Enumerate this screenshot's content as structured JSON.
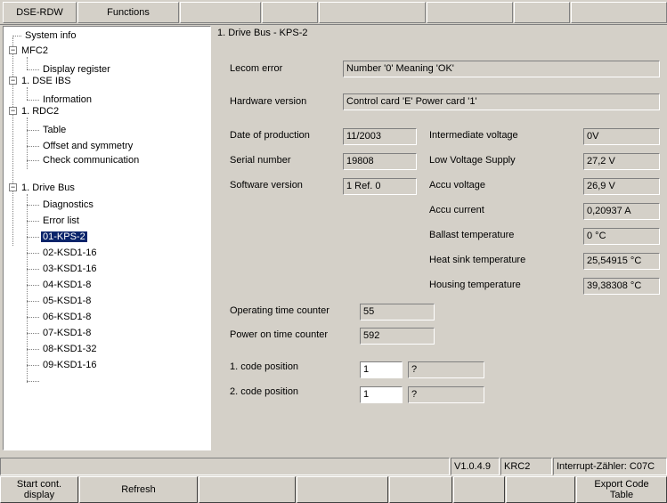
{
  "menu": {
    "tabs": [
      "DSE-RDW",
      "Functions"
    ]
  },
  "tree": {
    "items": [
      {
        "label": "System info"
      },
      {
        "label": "MFC2"
      },
      {
        "label": "Display register"
      },
      {
        "label": "1. DSE IBS"
      },
      {
        "label": "Information"
      },
      {
        "label": "1. RDC2"
      },
      {
        "label": "Table"
      },
      {
        "label": "Offset and symmetry"
      },
      {
        "label": "Check communication"
      },
      {
        "label": "1. Drive Bus"
      },
      {
        "label": "Diagnostics"
      },
      {
        "label": "Error list"
      },
      {
        "label": "01-KPS-2",
        "selected": true
      },
      {
        "label": "02-KSD1-16"
      },
      {
        "label": "03-KSD1-16"
      },
      {
        "label": "04-KSD1-8"
      },
      {
        "label": "05-KSD1-8"
      },
      {
        "label": "06-KSD1-8"
      },
      {
        "label": "07-KSD1-8"
      },
      {
        "label": "08-KSD1-32"
      },
      {
        "label": "09-KSD1-16"
      }
    ]
  },
  "panel": {
    "title": "1. Drive Bus - KPS-2",
    "lecom_error": {
      "label": "Lecom error",
      "value": "Number '0'  Meaning 'OK'"
    },
    "hardware_version": {
      "label": "Hardware version",
      "value": "Control card 'E'  Power card '1'"
    },
    "date_of_production": {
      "label": "Date of production",
      "value": "11/2003"
    },
    "serial_number": {
      "label": "Serial number",
      "value": "19808"
    },
    "software_version": {
      "label": "Software version",
      "value": "1 Ref. 0"
    },
    "intermediate_voltage": {
      "label": "Intermediate voltage",
      "value": "0V"
    },
    "low_voltage_supply": {
      "label": "Low Voltage Supply",
      "value": "27,2 V"
    },
    "accu_voltage": {
      "label": "Accu voltage",
      "value": "26,9 V"
    },
    "accu_current": {
      "label": "Accu current",
      "value": "0,20937 A"
    },
    "ballast_temperature": {
      "label": "Ballast temperature",
      "value": "0 °C"
    },
    "heat_sink_temperature": {
      "label": "Heat sink temperature",
      "value": "25,54915 °C"
    },
    "housing_temperature": {
      "label": "Housing temperature",
      "value": "39,38308 °C"
    },
    "operating_time_counter": {
      "label": "Operating time counter",
      "value": "55"
    },
    "power_on_time_counter": {
      "label": "Power on time counter",
      "value": "592"
    },
    "code_position_1": {
      "label": "1. code position",
      "value": "1",
      "meaning": "?"
    },
    "code_position_2": {
      "label": "2. code position",
      "value": "1",
      "meaning": "?"
    }
  },
  "status": {
    "version": "V1.0.4.9",
    "controller": "KRC2",
    "interrupt": "Interrupt-Zähler: C07C"
  },
  "buttons": {
    "start_cont_display": "Start cont.\ndisplay",
    "refresh": "Refresh",
    "export_code_table": "Export Code\nTable"
  }
}
